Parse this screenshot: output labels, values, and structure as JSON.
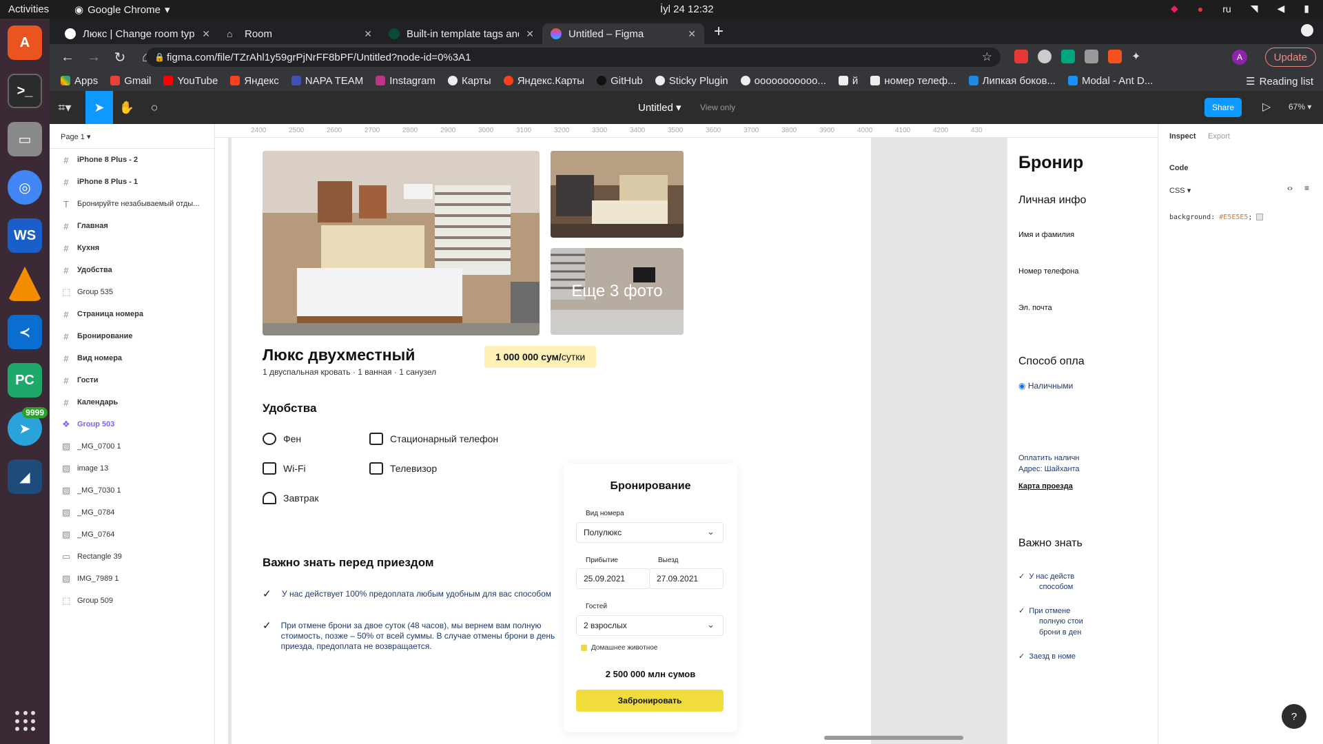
{
  "os": {
    "activities": "Activities",
    "app_name": "Google Chrome",
    "clock": "İyl 24  12:32",
    "lang": "ru"
  },
  "dock": {
    "telegram_badge": "9999"
  },
  "browser": {
    "tabs": [
      {
        "title": "Люкс | Change room type"
      },
      {
        "title": "Room"
      },
      {
        "title": "Built-in template tags and"
      },
      {
        "title": "Untitled – Figma"
      }
    ],
    "url": "figma.com/file/TZrAhl1y59grPjNrFF8bPF/Untitled?node-id=0%3A1",
    "update_label": "Update",
    "avatar_letter": "A",
    "bookmarks": [
      "Apps",
      "Gmail",
      "YouTube",
      "Яндекс",
      "NAPA TEAM",
      "Instagram",
      "Карты",
      "Яндекс.Карты",
      "GitHub",
      "Sticky Plugin",
      "ооооооооооо...",
      "й",
      "номер телеф...",
      "Липкая боков...",
      "Modal - Ant D..."
    ],
    "reading_list": "Reading list"
  },
  "figma": {
    "file_title": "Untitled",
    "view_only": "View only",
    "share_label": "Share",
    "zoom": "67%",
    "page": "Page 1",
    "layers": [
      {
        "name": "iPhone 8 Plus - 2",
        "type": "frame"
      },
      {
        "name": "iPhone 8 Plus - 1",
        "type": "frame"
      },
      {
        "name": "Бронируйте незабываемый отды...",
        "type": "text"
      },
      {
        "name": "Главная",
        "type": "frame"
      },
      {
        "name": "Кухня",
        "type": "frame"
      },
      {
        "name": "Удобства",
        "type": "frame"
      },
      {
        "name": "Group 535",
        "type": "group"
      },
      {
        "name": "Страница номера",
        "type": "frame"
      },
      {
        "name": "Бронирование",
        "type": "frame"
      },
      {
        "name": "Вид номера",
        "type": "frame"
      },
      {
        "name": "Гости",
        "type": "frame"
      },
      {
        "name": "Календарь",
        "type": "frame"
      },
      {
        "name": "Group 503",
        "type": "component"
      },
      {
        "name": "_MG_0700 1",
        "type": "image"
      },
      {
        "name": "image 13",
        "type": "image"
      },
      {
        "name": "_MG_7030 1",
        "type": "image"
      },
      {
        "name": "_MG_0784",
        "type": "image"
      },
      {
        "name": "_MG_0764",
        "type": "image"
      },
      {
        "name": "Rectangle 39",
        "type": "rect"
      },
      {
        "name": "IMG_7989 1",
        "type": "image"
      },
      {
        "name": "Group 509",
        "type": "group"
      }
    ],
    "ruler": [
      "2400",
      "2500",
      "2600",
      "2700",
      "2800",
      "2900",
      "3000",
      "3100",
      "3200",
      "3300",
      "3400",
      "3500",
      "3600",
      "3700",
      "3800",
      "3900",
      "4000",
      "4100",
      "4200",
      "430"
    ],
    "inspect": {
      "tab_inspect": "Inspect",
      "tab_export": "Export",
      "code": "Code",
      "lang": "CSS",
      "css_prop": "background:",
      "css_value": "#E5E5E5",
      "help": "?"
    }
  },
  "design": {
    "more_photos": "Еще 3 фото",
    "room_title": "Люкс двухместный",
    "room_sub": "1 двуспальная кровать · 1 ванная · 1 санузел",
    "price_bold": "1 000 000 сум/",
    "price_unit": "сутки",
    "amenities_title": "Удобства",
    "amenities": [
      "Фен",
      "Стационарный телефон",
      "Wi-Fi",
      "Телевизор",
      "Завтрак"
    ],
    "important_title": "Важно знать перед приездом",
    "important": [
      "У нас действует 100% предоплата любым удобным для вас способом",
      "При отмене брони за двое суток (48 часов), мы вернем вам полную стоимость, позже – 50% от всей суммы.  В случае отмены брони в день приезда, предоплата не возвращается."
    ],
    "booking": {
      "title": "Бронирование",
      "room_type_label": "Вид номера",
      "room_type_value": "Полулюкс",
      "arrival_label": "Прибытие",
      "arrival_value": "25.09.2021",
      "departure_label": "Выезд",
      "departure_value": "27.09.2021",
      "guests_label": "Гостей",
      "guests_value": "2 взрослых",
      "pet_label": "Домашнее животное",
      "total": "2 500 000 млн сумов",
      "button": "Забронировать"
    },
    "frame2": {
      "title": "Бронир",
      "personal": "Личная инфо",
      "name_label": "Имя и фамилия",
      "phone_label": "Номер телефона",
      "email_label": "Эл. почта",
      "payment": "Способ опла",
      "cash": "Наличными",
      "pay_note": "Оплатить наличн",
      "address": "Адрес: Шайханта",
      "map_link": "Карта проезда",
      "important": "Важно знать",
      "items": [
        "У нас действ",
        "способом",
        "При отмене",
        "полную стои",
        "брони в ден",
        "Заезд в номе"
      ]
    }
  }
}
